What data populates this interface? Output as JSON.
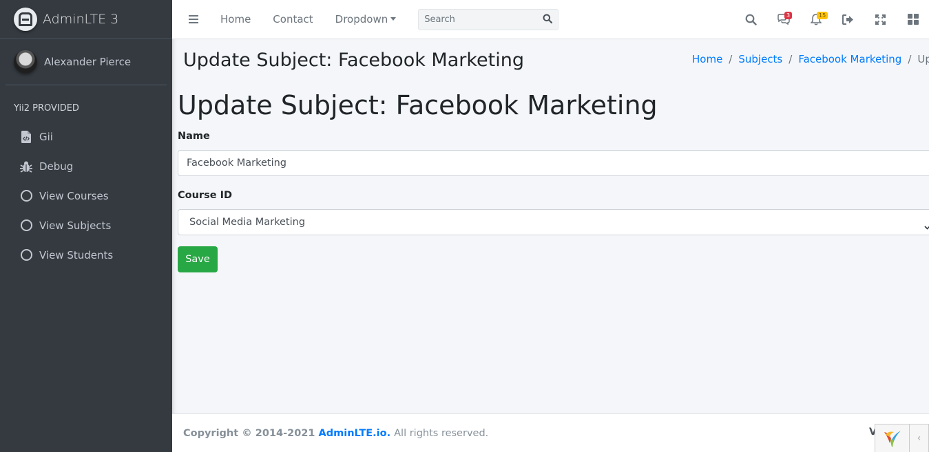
{
  "brand": {
    "name": "AdminLTE 3"
  },
  "user": {
    "name": "Alexander Pierce"
  },
  "sidebar": {
    "header": "Yii2 PROVIDED",
    "items": [
      {
        "label": "Gii",
        "icon": "file-code-icon"
      },
      {
        "label": "Debug",
        "icon": "bug-icon"
      },
      {
        "label": "View Courses",
        "icon": "circle-icon"
      },
      {
        "label": "View Subjects",
        "icon": "circle-icon"
      },
      {
        "label": "View Students",
        "icon": "circle-icon"
      }
    ]
  },
  "navbar": {
    "links": [
      "Home",
      "Contact",
      "Dropdown"
    ],
    "search_placeholder": "Search",
    "messages_badge": "3",
    "notifications_badge": "15"
  },
  "header": {
    "title": "Update Subject: Facebook Marketing",
    "breadcrumb": [
      "Home",
      "Subjects",
      "Facebook Marketing",
      "Update"
    ]
  },
  "form": {
    "heading": "Update Subject: Facebook Marketing",
    "name_label": "Name",
    "name_value": "Facebook Marketing",
    "course_label": "Course ID",
    "course_value": "Social Media Marketing",
    "save_label": "Save"
  },
  "footer": {
    "copyright": "Copyright © 2014-2021",
    "link": "AdminLTE.io.",
    "rest": "All rights reserved.",
    "version_fragment": "V"
  },
  "colors": {
    "sidebar_bg": "#343a40",
    "primary": "#007bff",
    "success": "#28a745",
    "danger": "#dc3545",
    "warning": "#ffc107"
  }
}
